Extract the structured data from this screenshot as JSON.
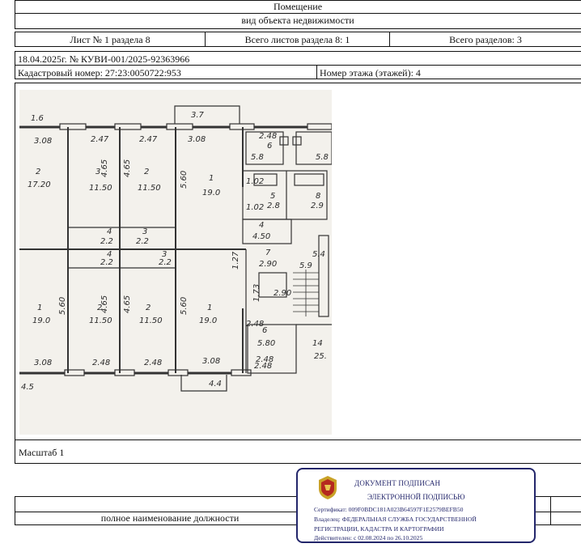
{
  "header": {
    "title": "Помещение",
    "subtitle": "вид объекта недвижимости"
  },
  "sheet_row": {
    "sheet": "Лист № 1 раздела 8",
    "total_sheets": "Всего листов раздела 8: 1",
    "total_sections": "Всего разделов: 3"
  },
  "doc_row": {
    "date_number": "18.04.2025г. № КУВИ-001/2025-92363966"
  },
  "cadastral_row": {
    "cadastral": "Кадастровый номер: 27:23:0050722:953",
    "floor": "Номер этажа (этажей): 4"
  },
  "plan": {
    "labels": {
      "r_top_left_dim": "3.08",
      "r_top_2": "2.47",
      "r_top_3": "2.47",
      "r_top_4": "3.08",
      "r_top_5": "2.48",
      "r_top_37": "3.7",
      "r_top_16": "1.6",
      "room2_num": "2",
      "room2_area": "17.20",
      "room3_num": "3",
      "room3_area": "11.50",
      "room2b_num": "2",
      "room2b_area": "11.50",
      "room1_num": "1",
      "room1_area": "19.0",
      "h_465a": "4.65",
      "h_465b": "4.65",
      "h_560": "5.60",
      "room6_num": "6",
      "room6_area": "5.8",
      "room5r_area": "5.8",
      "room5_num": "5",
      "room5_area": "2.8",
      "room8_num": "8",
      "room8_area": "2.9",
      "room4_num": "4",
      "room4_area": "4.50",
      "d102a": "1.02",
      "d102b": "1.02",
      "room4b_num": "4",
      "room4b_area": "2.2",
      "room3b_num": "3",
      "room3b_area": "2.2",
      "room4c_num": "4",
      "room4c_area": "2.2",
      "room3c_num": "3",
      "room3c_area": "2.2",
      "room7_num": "7",
      "room7_area": "2.90",
      "d59": "5.9",
      "d54": "5.4",
      "d127": "1.27",
      "d173": "1.73",
      "room5b_area": "2.90",
      "rb_room1_num": "1",
      "rb_room1_area": "19.0",
      "rb_room2_num": "2",
      "rb_room2_area": "11.50",
      "rb_room2b_num": "2",
      "rb_room2b_area": "11.50",
      "rb_room1b_num": "1",
      "rb_room1b_area": "19.0",
      "rb_560a": "5.60",
      "rb_465a": "4.65",
      "rb_465b": "4.65",
      "rb_560b": "5.60",
      "rb_room6_num": "6",
      "rb_room6_area": "5.80",
      "rb_248": "2.48",
      "rb_248b": "2.48",
      "room14_num": "14",
      "room14_area": "25.",
      "bot_308a": "3.08",
      "bot_248a": "2.48",
      "bot_248b": "2.48",
      "bot_308b": "3.08",
      "bot_248c": "2.48",
      "bot_44": "4.4",
      "bot_45": "4.5"
    }
  },
  "scale": {
    "label": "Масштаб 1"
  },
  "footer": {
    "position_caption": "полное наименование должности"
  },
  "stamp": {
    "line1": "ДОКУМЕНТ ПОДПИСАН",
    "line2": "ЭЛЕКТРОННОЙ ПОДПИСЬЮ",
    "cert": "Сертификат: 009F0BDC181A023B64597F1E2579BEFB50",
    "owner1": "Владелец: ФЕДЕРАЛЬНАЯ СЛУЖБА ГОСУДАРСТВЕННОЙ",
    "owner2": "РЕГИСТРАЦИИ, КАДАСТРА И КАРТОГРАФИИ",
    "valid": "Действителен: с 02.08.2024 по 26.10.2025",
    "color": "#23266b"
  }
}
